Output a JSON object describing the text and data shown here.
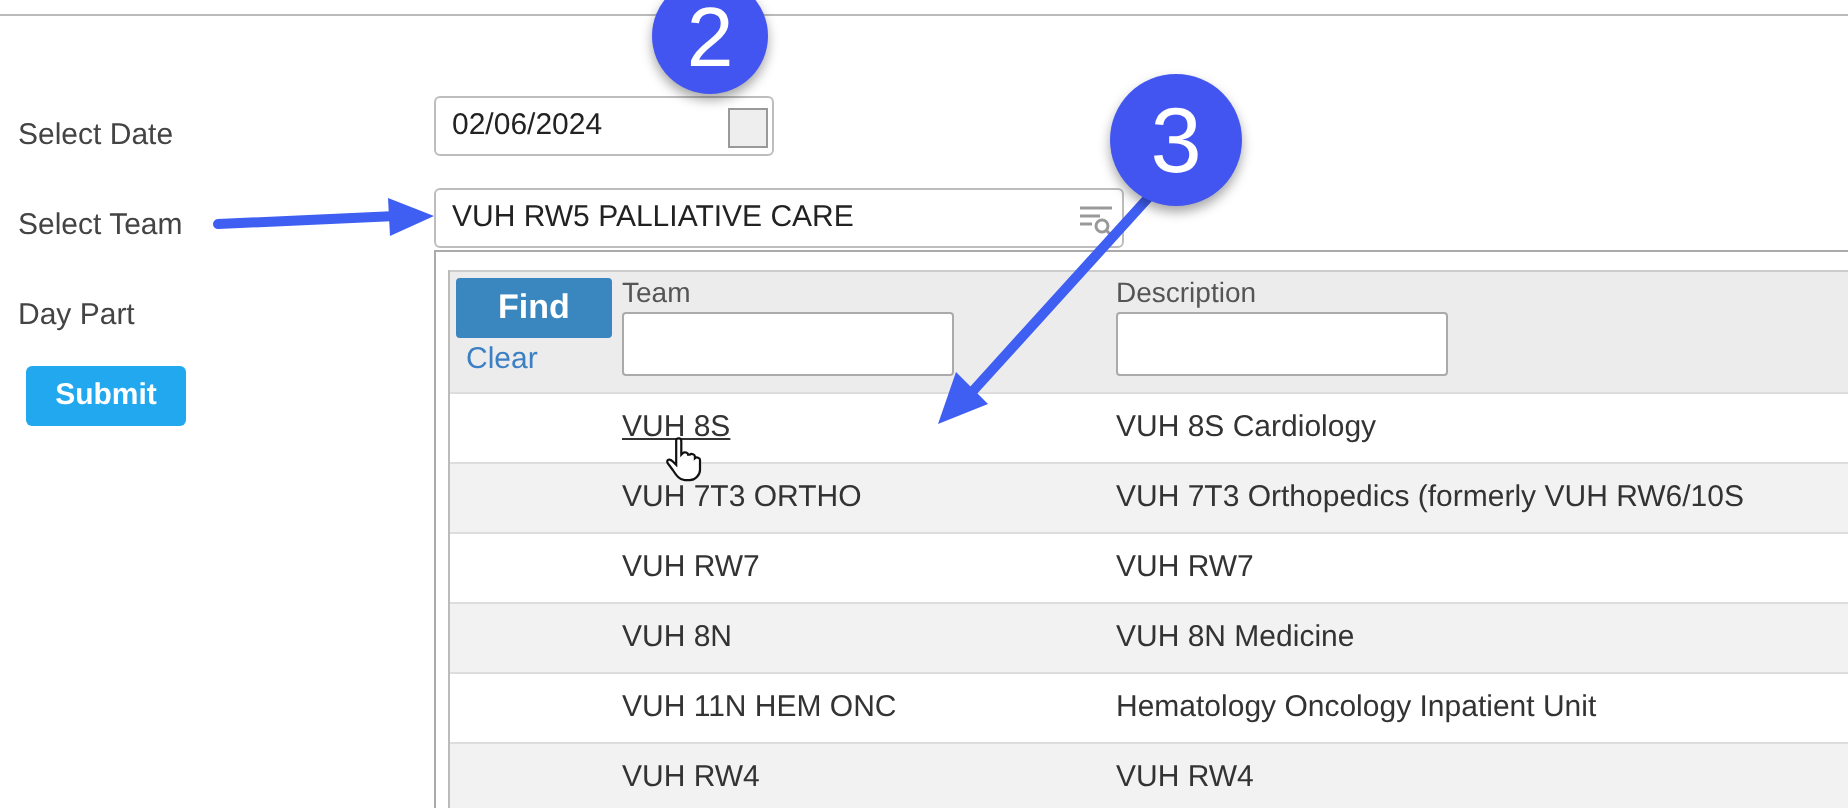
{
  "form": {
    "fields": [
      {
        "label": "Select Date",
        "kind": "date",
        "value": "02/06/2024"
      },
      {
        "label": "Select Team",
        "kind": "lookup",
        "value": "VUH RW5 PALLIATIVE CARE"
      },
      {
        "label": "Day Part",
        "kind": "none"
      }
    ],
    "submit": "Submit"
  },
  "lookup": {
    "find": "Find",
    "clear": "Clear",
    "columns": [
      "Team",
      "Description"
    ],
    "rows": [
      {
        "team": "VUH 8S",
        "description": "VUH 8S Cardiology",
        "hovered": true
      },
      {
        "team": "VUH 7T3 ORTHO",
        "description": "VUH 7T3 Orthopedics (formerly VUH RW6/10S",
        "hovered": false
      },
      {
        "team": "VUH RW7",
        "description": "VUH RW7",
        "hovered": false
      },
      {
        "team": "VUH 8N",
        "description": "VUH 8N Medicine",
        "hovered": false
      },
      {
        "team": "VUH 11N HEM ONC",
        "description": "Hematology Oncology Inpatient Unit",
        "hovered": false
      },
      {
        "team": "VUH RW4",
        "description": "VUH RW4",
        "hovered": false
      }
    ]
  },
  "annotations": [
    {
      "label": "2"
    },
    {
      "label": "3"
    }
  ]
}
